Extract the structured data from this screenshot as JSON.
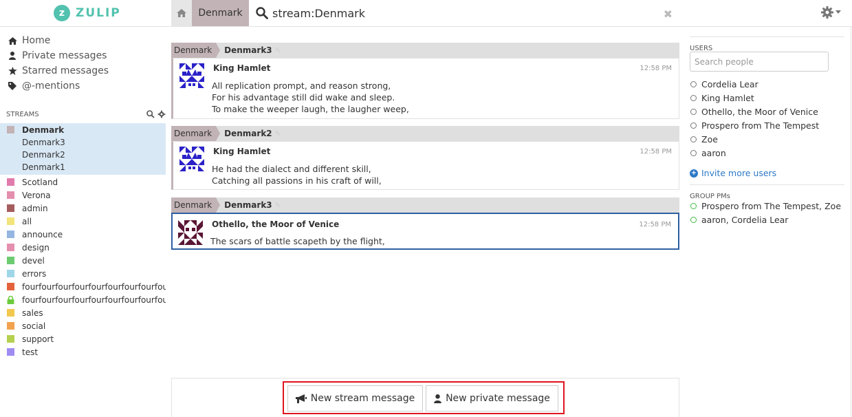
{
  "app": {
    "logo_letter": "z",
    "logo_text": "ZULIP"
  },
  "header": {
    "stream_tab": "Denmark",
    "search_query": "stream:Denmark"
  },
  "nav": {
    "items": [
      {
        "label": "Home",
        "icon": "home-icon"
      },
      {
        "label": "Private messages",
        "icon": "user-icon"
      },
      {
        "label": "Starred messages",
        "icon": "star-icon"
      },
      {
        "label": "@-mentions",
        "icon": "tag-icon"
      }
    ]
  },
  "streams": {
    "heading": "STREAMS",
    "active": {
      "name": "Denmark",
      "color": "#c2b3b6",
      "topics": [
        "Denmark3",
        "Denmark2",
        "Denmark1"
      ]
    },
    "list": [
      {
        "name": "Scotland",
        "color": "#e07bab"
      },
      {
        "name": "Verona",
        "color": "#e58fae"
      },
      {
        "name": "admin",
        "color": "#a55c5c"
      },
      {
        "name": "all",
        "color": "#f2e37b"
      },
      {
        "name": "announce",
        "color": "#94b6e0"
      },
      {
        "name": "design",
        "color": "#e58fae"
      },
      {
        "name": "devel",
        "color": "#6ccb70"
      },
      {
        "name": "errors",
        "color": "#9fd7e8"
      },
      {
        "name": "fourfourfourfourfourfourfourfourfourfour",
        "color": "#e3623c"
      },
      {
        "name": "fourfourfourfourfourfourfourfourfourfour",
        "color": "#6ccb3d",
        "locked": true
      },
      {
        "name": "sales",
        "color": "#f2c84e"
      },
      {
        "name": "social",
        "color": "#f2a24e"
      },
      {
        "name": "support",
        "color": "#b5d04e"
      },
      {
        "name": "test",
        "color": "#9f8cf2"
      }
    ]
  },
  "messages": [
    {
      "stream": "Denmark",
      "topic": "Denmark3",
      "sender": "King Hamlet",
      "time": "12:58 PM",
      "lines": [
        "All replication prompt, and reason strong,",
        "For his advantage still did wake and sleep.",
        "To make the weeper laugh, the laugher weep,"
      ]
    },
    {
      "stream": "Denmark",
      "topic": "Denmark2",
      "sender": "King Hamlet",
      "time": "12:58 PM",
      "lines": [
        "He had the dialect and different skill,",
        "Catching all passions in his craft of will,"
      ]
    },
    {
      "stream": "Denmark",
      "topic": "Denmark3",
      "sender": "Othello, the Moor of Venice",
      "time": "12:58 PM",
      "lines": [
        "The scars of battle scapeth by the flight,"
      ]
    }
  ],
  "compose": {
    "stream_button": "New stream message",
    "private_button": "New private message"
  },
  "users": {
    "heading": "USERS",
    "search_placeholder": "Search people",
    "list": [
      "Cordelia Lear",
      "King Hamlet",
      "Othello, the Moor of Venice",
      "Prospero from The Tempest",
      "Zoe",
      "aaron"
    ],
    "invite_label": "Invite more users"
  },
  "group_pms": {
    "heading": "GROUP PMs",
    "list": [
      "Prospero from The Tempest, Zoe",
      "aaron, Cordelia Lear"
    ]
  },
  "colors": {
    "accent": "#52c2af",
    "link": "#2b78c5",
    "highlight": "#e0141e",
    "selected_border": "#2e5fa3"
  }
}
